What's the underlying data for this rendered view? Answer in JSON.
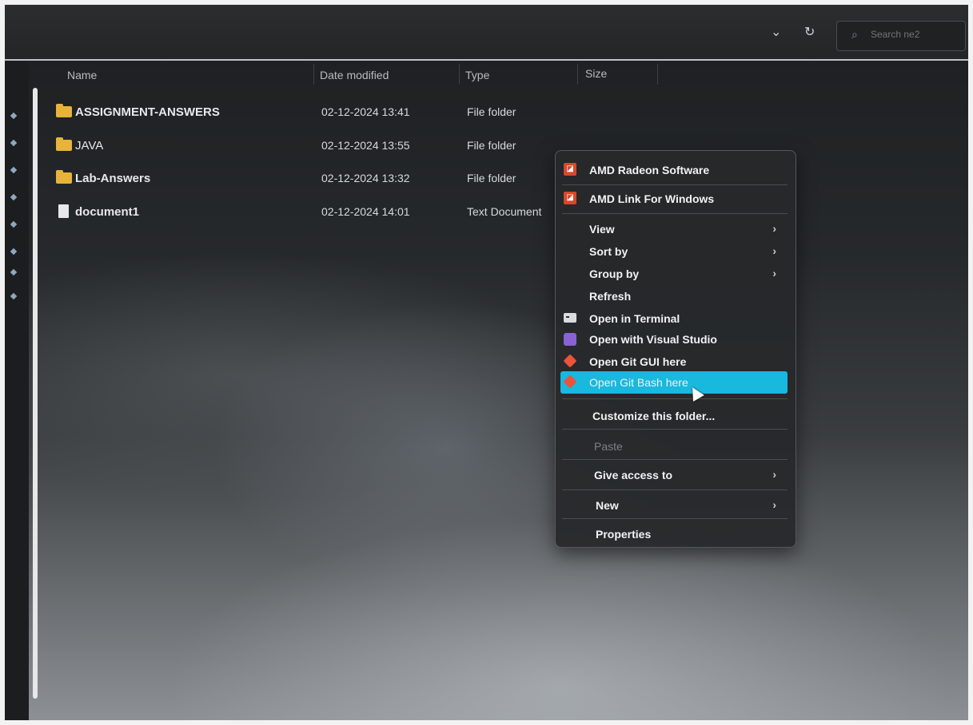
{
  "toolbar": {
    "chevron": "⌄",
    "refresh": "↻",
    "search_placeholder": "Search ne2"
  },
  "columns": {
    "name": "Name",
    "date": "Date modified",
    "type": "Type",
    "size": "Size"
  },
  "files": [
    {
      "name": "ASSIGNMENT-ANSWERS",
      "date": "02-12-2024 13:41",
      "type": "File folder",
      "icon": "folder-icon"
    },
    {
      "name": "JAVA",
      "date": "02-12-2024 13:55",
      "type": "File folder",
      "icon": "folder-icon"
    },
    {
      "name": "Lab-Answers",
      "date": "02-12-2024 13:32",
      "type": "File folder",
      "icon": "folder-icon"
    },
    {
      "name": "document1",
      "date": "02-12-2024 14:01",
      "type": "Text Document",
      "icon": "document-icon"
    }
  ],
  "context_menu": {
    "amd_radeon": "AMD Radeon Software",
    "amd_link": "AMD Link For Windows",
    "view": "View",
    "sort_by": "Sort by",
    "group_by": "Group by",
    "refresh": "Refresh",
    "open_terminal": "Open in Terminal",
    "open_vs": "Open with Visual Studio",
    "open_git_gui": "Open Git GUI here",
    "open_git_bash": "Open Git Bash here",
    "customize": "Customize this folder...",
    "paste": "Paste",
    "give_access": "Give access to",
    "new": "New",
    "properties": "Properties",
    "chevron": "›",
    "highlight_color": "#19b8dd"
  }
}
